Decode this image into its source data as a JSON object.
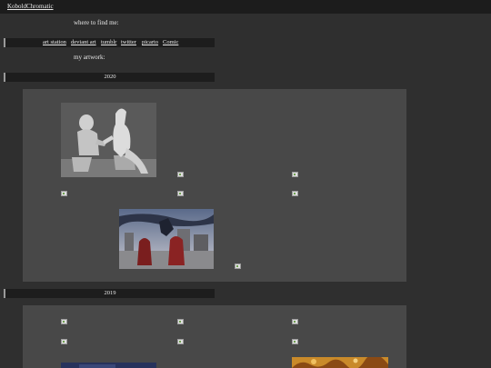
{
  "header": {
    "site_name": "KoboldChromatic"
  },
  "find_me": {
    "label": "where to find me:",
    "links": [
      "art station",
      "deviant art",
      "tumblr",
      "twitter",
      "picarto",
      "Comic"
    ]
  },
  "artwork_label": "my artwork:",
  "sections": [
    {
      "year": "2020"
    },
    {
      "year": "2019"
    }
  ]
}
